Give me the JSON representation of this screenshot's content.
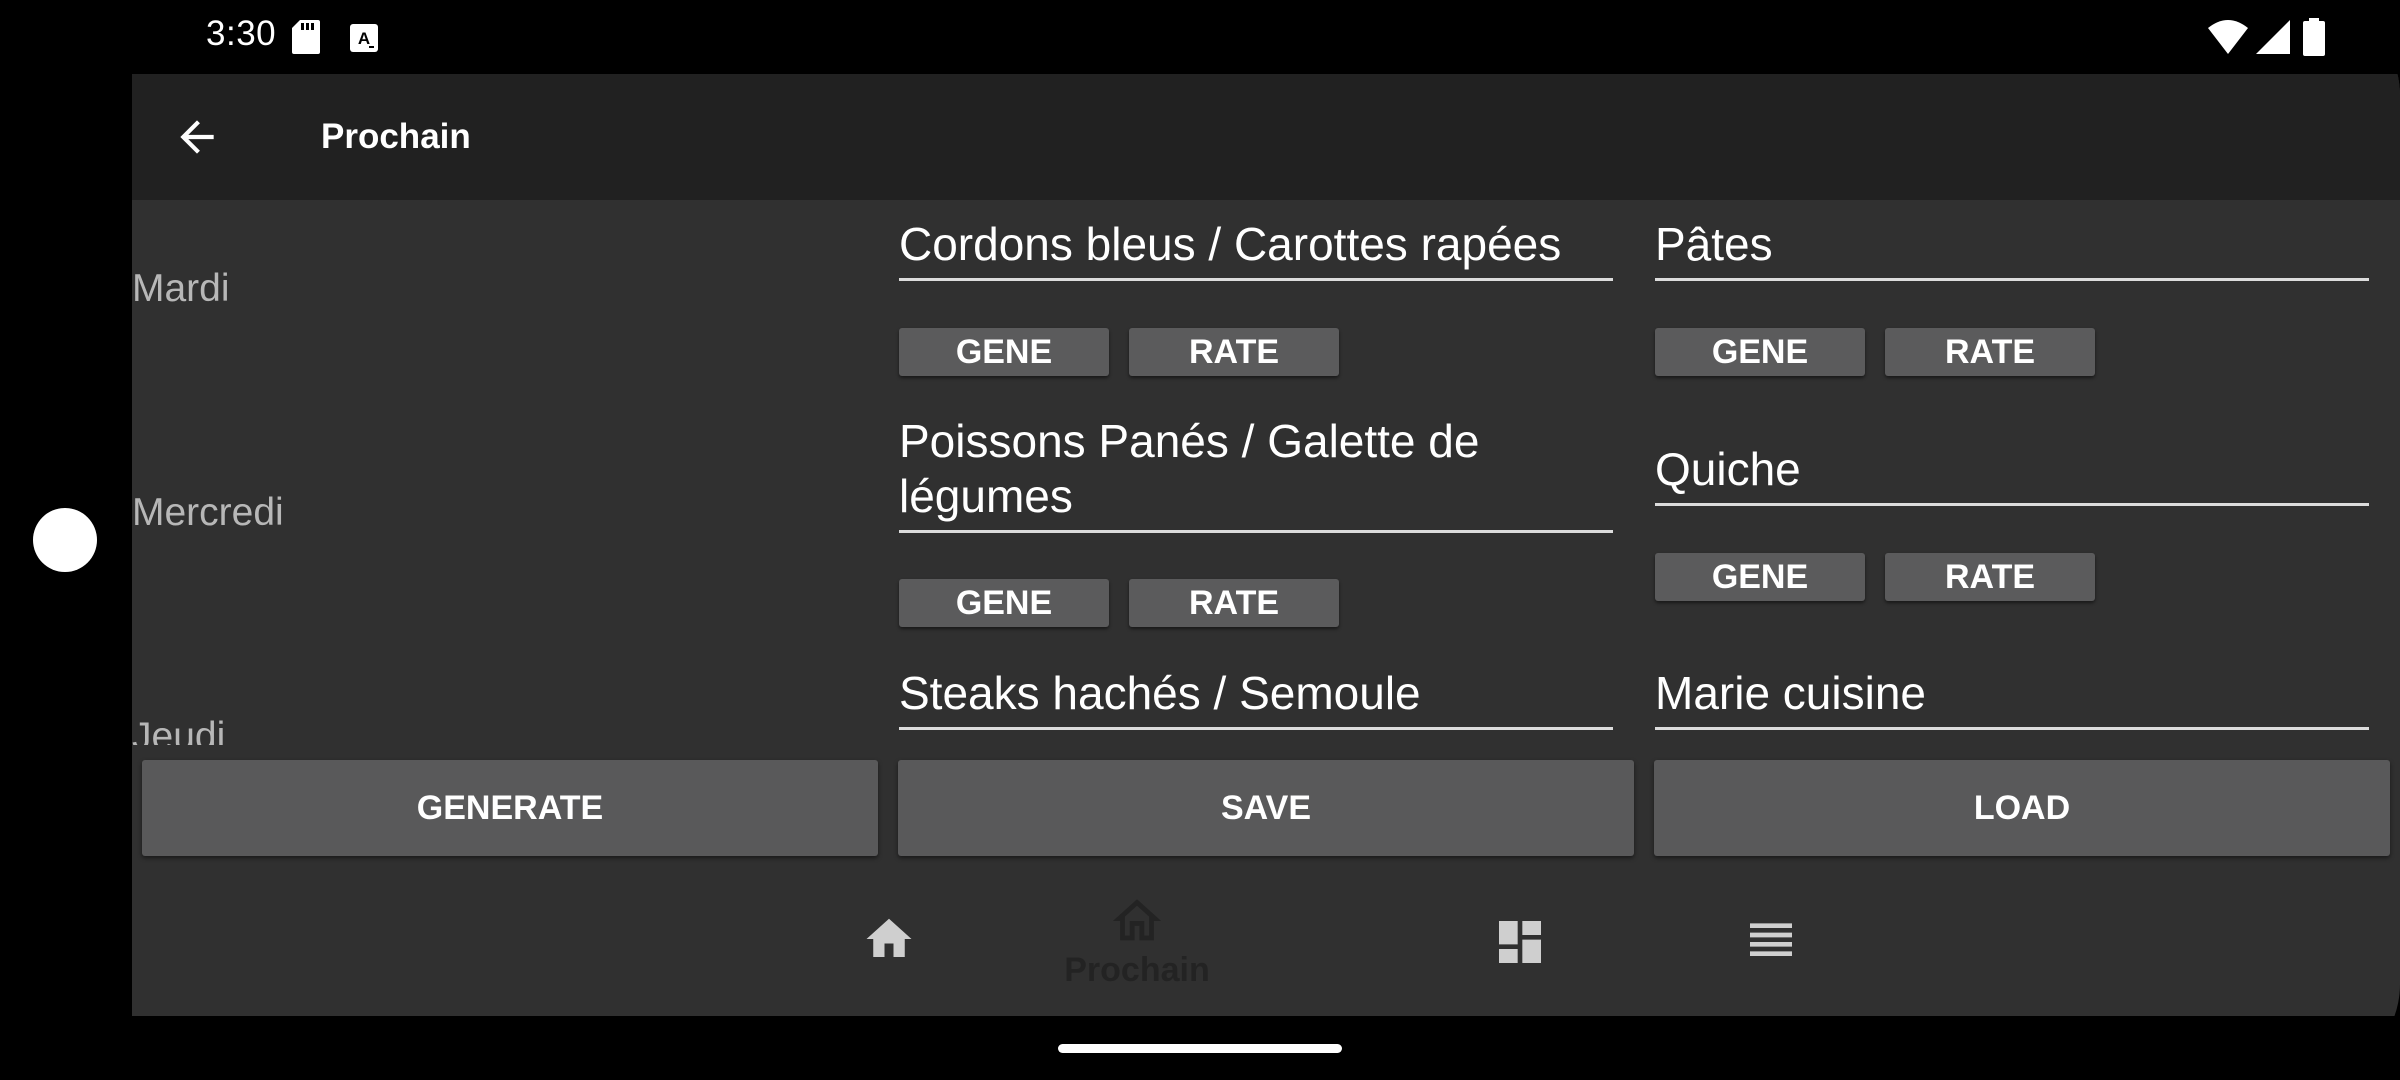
{
  "status_bar": {
    "time": "3:30"
  },
  "app_bar": {
    "title": "Prochain"
  },
  "days": [
    {
      "name": "Mardi",
      "meals": [
        {
          "name": "Cordons bleus / Carottes rapées",
          "gene_label": "GENE",
          "rate_label": "RATE"
        },
        {
          "name": "Pâtes",
          "gene_label": "GENE",
          "rate_label": "RATE"
        }
      ]
    },
    {
      "name": "Mercredi",
      "meals": [
        {
          "name": "Poissons Panés / Galette de légumes",
          "gene_label": "GENE",
          "rate_label": "RATE"
        },
        {
          "name": "Quiche",
          "gene_label": "GENE",
          "rate_label": "RATE"
        }
      ]
    },
    {
      "name": "Jeudi",
      "meals": [
        {
          "name": "Steaks hachés / Semoule"
        },
        {
          "name": "Marie cuisine"
        }
      ]
    }
  ],
  "actions": {
    "generate": "GENERATE",
    "save": "SAVE",
    "load": "LOAD"
  },
  "bottom_nav": {
    "items": [
      {
        "icon": "home-icon"
      },
      {
        "icon": "home-outline-icon",
        "label": "Prochain",
        "selected": true
      },
      {
        "icon": "dashboard-icon"
      },
      {
        "icon": "list-icon"
      }
    ]
  },
  "colors": {
    "background": "#303030",
    "app_bar": "#212121",
    "button": "#5b5b5c",
    "text": "#ffffff",
    "day_text": "#b7b7b7"
  }
}
